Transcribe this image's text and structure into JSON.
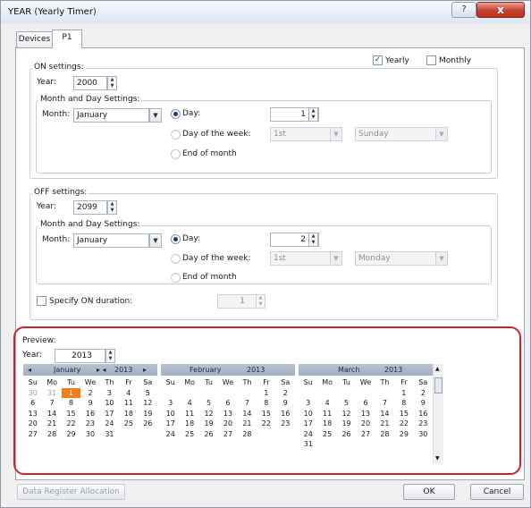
{
  "window": {
    "title": "YEAR (Yearly Timer)",
    "help": "?",
    "close": "x"
  },
  "tabs": [
    "Devices",
    "P1"
  ],
  "period": {
    "yearly": "Yearly",
    "monthly": "Monthly",
    "yearly_checked": true,
    "monthly_checked": false
  },
  "on": {
    "title": "ON settings:",
    "year_label": "Year:",
    "year": "2000",
    "md_title": "Month and Day Settings:",
    "month_label": "Month:",
    "month": "January",
    "day_label": "Day:",
    "day": "1",
    "dow_label": "Day of the week:",
    "week": "1st",
    "weekday": "Sunday",
    "eom_label": "End of month"
  },
  "off": {
    "title": "OFF settings:",
    "year_label": "Year:",
    "year": "2099",
    "md_title": "Month and Day Settings:",
    "month_label": "Month:",
    "month": "January",
    "day_label": "Day:",
    "day": "2",
    "dow_label": "Day of the week:",
    "week": "1st",
    "weekday": "Monday",
    "eom_label": "End of month"
  },
  "duration": {
    "label": "Specify ON duration:",
    "value": "1"
  },
  "preview": {
    "title": "Preview:",
    "year_label": "Year:",
    "year": "2013",
    "calendars": [
      {
        "month": "January",
        "year": "2013",
        "prev": "◂",
        "next_month": "▸",
        "prev_year": "▸ ◂",
        "next_year": "▸",
        "weekdays": [
          "Su",
          "Mo",
          "Tu",
          "We",
          "Th",
          "Fr",
          "Sa"
        ],
        "days": [
          "30",
          "31",
          "1",
          "2",
          "3",
          "4",
          "5",
          "6",
          "7",
          "8",
          "9",
          "10",
          "11",
          "12",
          "13",
          "14",
          "15",
          "16",
          "17",
          "18",
          "19",
          "20",
          "21",
          "22",
          "23",
          "24",
          "25",
          "26",
          "27",
          "28",
          "29",
          "30",
          "31",
          "",
          "",
          "",
          "",
          "",
          "",
          "",
          "",
          "",
          "",
          ""
        ],
        "dim": [
          0,
          1
        ],
        "today": 2
      },
      {
        "month": "February",
        "year": "2013",
        "weekdays": [
          "Su",
          "Mo",
          "Tu",
          "We",
          "Th",
          "Fr",
          "Sa"
        ],
        "days": [
          "",
          "",
          "",
          "",
          "",
          "1",
          "2",
          "3",
          "4",
          "5",
          "6",
          "7",
          "8",
          "9",
          "10",
          "11",
          "12",
          "13",
          "14",
          "15",
          "16",
          "17",
          "18",
          "19",
          "20",
          "21",
          "22",
          "23",
          "24",
          "25",
          "26",
          "27",
          "28",
          "",
          "",
          "",
          "",
          "",
          "",
          "",
          "",
          "",
          "",
          ""
        ],
        "dim": [],
        "today": -1
      },
      {
        "month": "March",
        "year": "2013",
        "weekdays": [
          "Su",
          "Mo",
          "Tu",
          "We",
          "Th",
          "Fr",
          "Sa"
        ],
        "days": [
          "",
          "",
          "",
          "",
          "",
          "1",
          "2",
          "3",
          "4",
          "5",
          "6",
          "7",
          "8",
          "9",
          "10",
          "11",
          "12",
          "13",
          "14",
          "15",
          "16",
          "17",
          "18",
          "19",
          "20",
          "21",
          "22",
          "23",
          "24",
          "25",
          "26",
          "27",
          "28",
          "29",
          "30",
          "31",
          "",
          "",
          "",
          "",
          "",
          ""
        ],
        "dim": [],
        "today": -1
      }
    ]
  },
  "buttons": {
    "data_register": "Data Register Allocation",
    "ok": "OK",
    "cancel": "Cancel"
  }
}
